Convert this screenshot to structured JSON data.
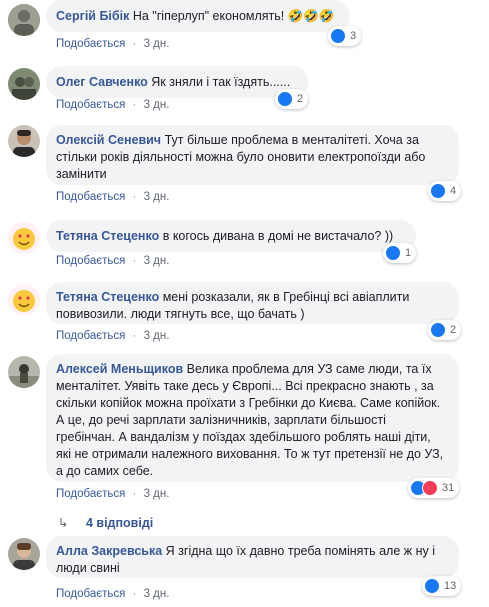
{
  "action_like": "Подобається",
  "separator": "·",
  "comments": [
    {
      "author": "Сергій Бібік",
      "text": "На \"гіперлуп\" економлять! 🤣🤣🤣",
      "time": "3 дн.",
      "reactions": [
        "like"
      ],
      "count": "3"
    },
    {
      "author": "Олег Савченко",
      "text": "Як зняли і так їздять......",
      "time": "3 дн.",
      "reactions": [
        "like"
      ],
      "count": "2"
    },
    {
      "author": "Олексій Сеневич",
      "text": "Тут більше проблема в менталітеті. Хоча за стільки років діяльності можна було оновити електропоїзди або замінити",
      "time": "3 дн.",
      "reactions": [
        "like"
      ],
      "count": "4"
    },
    {
      "author": "Тетяна Стеценко",
      "text": "в когось дивана в домі не вистачало? ))",
      "time": "3 дн.",
      "reactions": [
        "like"
      ],
      "count": "1"
    },
    {
      "author": "Тетяна Стеценко",
      "text": "мені розказали, як в Гребінці всі авіаплити повивозили. люди тягнуть все, що бачать )",
      "time": "3 дн.",
      "reactions": [
        "like"
      ],
      "count": "2"
    },
    {
      "author": "Алексей Меньщиков",
      "text": "Велика проблема для УЗ саме люди, та їх менталітет. Уявіть таке десь у Європі... Всі прекрасно знають , за скільки копійок можна проїхати з Гребінки до Києва. Саме копійок. А це, до речі зарплати залізничників, зарплати більшості гребінчан. А вандалізм у поїздах здебільшого роблять наші діти, які не отримали належного виховання. То ж тут претензії не до УЗ, а до самих себе.",
      "time": "3 дн.",
      "reactions": [
        "like",
        "love"
      ],
      "count": "31"
    },
    {
      "author": "Алла Закревська",
      "text": "Я згідна що їх давно треба помінять але ж ну і люди свині",
      "time": "3 дн.",
      "reactions": [
        "like"
      ],
      "count": "13"
    }
  ],
  "replies_label": "4 відповіді",
  "colors": {
    "link": "#385898",
    "bubble": "#f2f3f5",
    "meta": "#606770"
  }
}
